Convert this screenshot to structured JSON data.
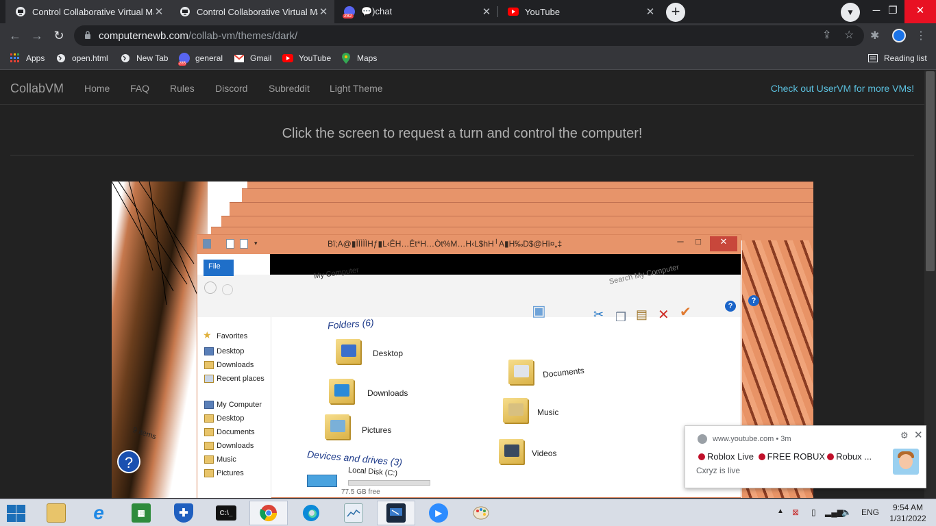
{
  "browser": {
    "tabs": [
      {
        "title": "Control Collaborative Virtual Mac",
        "close": "✕"
      },
      {
        "title": "Control Collaborative Virtual Mac",
        "close": "✕"
      },
      {
        "title": "💬)chat",
        "badge": "282",
        "close": "✕"
      },
      {
        "title": "YouTube",
        "close": "✕"
      }
    ],
    "new_tab": "+",
    "url_host": "computernewb.com",
    "url_path": "/collab-vm/themes/dark/",
    "bookmarks": [
      {
        "label": "Apps",
        "icon": "apps-grid-icon"
      },
      {
        "label": "open.html",
        "icon": "globe-icon"
      },
      {
        "label": "New Tab",
        "icon": "globe-icon"
      },
      {
        "label": "general",
        "icon": "discord-icon",
        "badge": "285"
      },
      {
        "label": "Gmail",
        "icon": "gmail-icon"
      },
      {
        "label": "YouTube",
        "icon": "youtube-icon"
      },
      {
        "label": "Maps",
        "icon": "maps-icon"
      }
    ],
    "reading_list": "Reading list"
  },
  "site": {
    "brand": "CollabVM",
    "nav": [
      "Home",
      "FAQ",
      "Rules",
      "Discord",
      "Subreddit",
      "Light Theme"
    ],
    "nav_right": "Check out UserVM for more VMs!",
    "headline": "Click the screen to request a turn and control the computer!"
  },
  "vm": {
    "window_title": "Bï;A@▮ÌÌÌÌÌHƒ▮L‹ÊH…Êt*H…Òt%M…H‹L$hH╵A▮H‰D$@Hï¤„‡",
    "file_tab": "File",
    "sections": [
      "Folders (6)",
      "Devices and drives (3)"
    ],
    "folders": [
      "Desktop",
      "Downloads",
      "Pictures",
      "Documents",
      "Music",
      "Videos"
    ],
    "sidebar": [
      "Favorites",
      "Desktop",
      "Downloads",
      "Recent places",
      "My Computer",
      "Desktop",
      "Documents",
      "Downloads",
      "Music",
      "Pictures"
    ],
    "search_placeholder": "Search My Computer",
    "breadcrumb": "My Computer",
    "disk_label": "Local Disk (C:)",
    "disk_free": "77.5 GB free",
    "items_label": "9 items"
  },
  "notification": {
    "source": "www.youtube.com",
    "age": "3m",
    "message_parts": [
      "Roblox Live",
      "FREE ROBUX",
      "Robux ..."
    ],
    "sub": "Cxryz is live"
  },
  "taskbar": {
    "language": "ENG",
    "time": "9:54 AM",
    "date": "1/31/2022"
  },
  "colors": {
    "accent_link": "#5bc0de",
    "vm_title_bar": "#e7946a",
    "close_red": "#c8473b"
  }
}
